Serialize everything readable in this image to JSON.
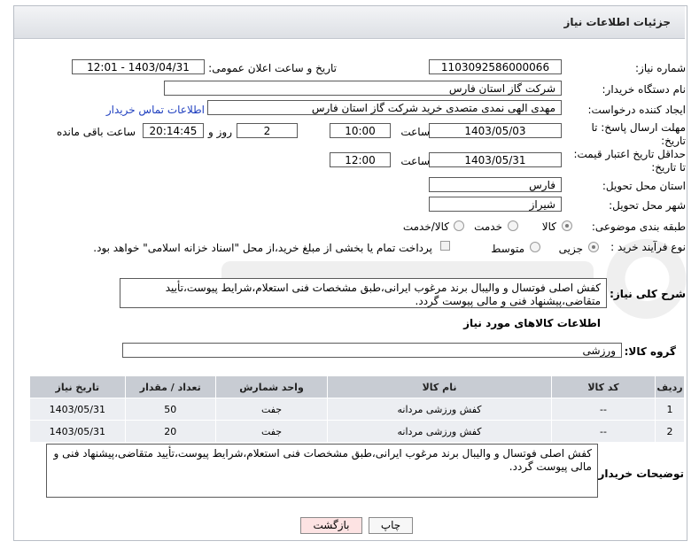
{
  "header": {
    "title": "جزئیات اطلاعات نیاز"
  },
  "labels": {
    "need_number": "شماره نیاز:",
    "announce_datetime": "تاریخ و ساعت اعلان عمومی:",
    "buyer_org": "نام دستگاه خریدار:",
    "requester": "ایجاد کننده درخواست:",
    "reply_deadline": "مهلت ارسال پاسخ: تا تاریخ:",
    "time": "ساعت",
    "day_and": "روز و",
    "time_remaining": "ساعت باقی مانده",
    "price_validity": "حداقل تاریخ اعتبار قیمت: تا تاریخ:",
    "delivery_province": "استان محل تحویل:",
    "delivery_city": "شهر محل تحویل:",
    "category": "طبقه بندی موضوعی:",
    "process_type": "نوع فرآیند خرید :",
    "general_desc": "شرح کلی نیاز:",
    "goods_info": "اطلاعات کالاهای مورد نیاز",
    "goods_group": "گروه کالا:",
    "buyer_notes": "توضیحات خریدار:"
  },
  "fields": {
    "need_number": "1103092586000066",
    "announce_datetime": "1403/04/31 - 12:01",
    "buyer_org": "شرکت گاز استان فارس",
    "requester": "مهدی الهی نمدی متصدی خرید شرکت گاز استان فارس",
    "buyer_contact_link": "اطلاعات تماس خریدار",
    "reply_date": "1403/05/03",
    "reply_time": "10:00",
    "reply_days": "2",
    "reply_remaining": "20:14:45",
    "validity_date": "1403/05/31",
    "validity_time": "12:00",
    "province": "فارس",
    "city": "شیراز",
    "goods_group": "ورزشی"
  },
  "category_options": [
    "کالا",
    "خدمت",
    "کالا/خدمت"
  ],
  "category_selected": "کالا",
  "process_options": [
    "جزیی",
    "متوسط"
  ],
  "process_selected": "جزیی",
  "payment_note": "پرداخت تمام یا بخشی از مبلغ خرید،از محل \"اسناد خزانه اسلامی\" خواهد بود.",
  "general_desc_text": "کفش اصلی فوتسال و والیبال برند مرغوب ایرانی،طبق مشخصات فنی استعلام،شرایط پیوست،تأیید متقاضی،پیشنهاد فنی و مالی پیوست گردد.",
  "table": {
    "headers": [
      "ردیف",
      "کد کالا",
      "نام کالا",
      "واحد شمارش",
      "تعداد / مقدار",
      "تاریخ نیاز"
    ],
    "rows": [
      [
        "1",
        "--",
        "کفش ورزشی مردانه",
        "جفت",
        "50",
        "1403/05/31"
      ],
      [
        "2",
        "--",
        "کفش ورزشی مردانه",
        "جفت",
        "20",
        "1403/05/31"
      ]
    ]
  },
  "buyer_notes_text": "کفش اصلی فوتسال و والیبال برند مرغوب ایرانی،طبق مشخصات فنی استعلام،شرایط پیوست،تأیید متقاضی،پیشنهاد فنی و مالی پیوست گردد.",
  "buttons": {
    "print": "چاپ",
    "back": "بازگشت"
  },
  "colors": {
    "header_bg": "#dde0e5",
    "table_header_bg": "#c8ccd3",
    "table_row_bg": "#eceef2",
    "back_button_bg": "#fde3e3",
    "link": "#1f3fbf"
  }
}
